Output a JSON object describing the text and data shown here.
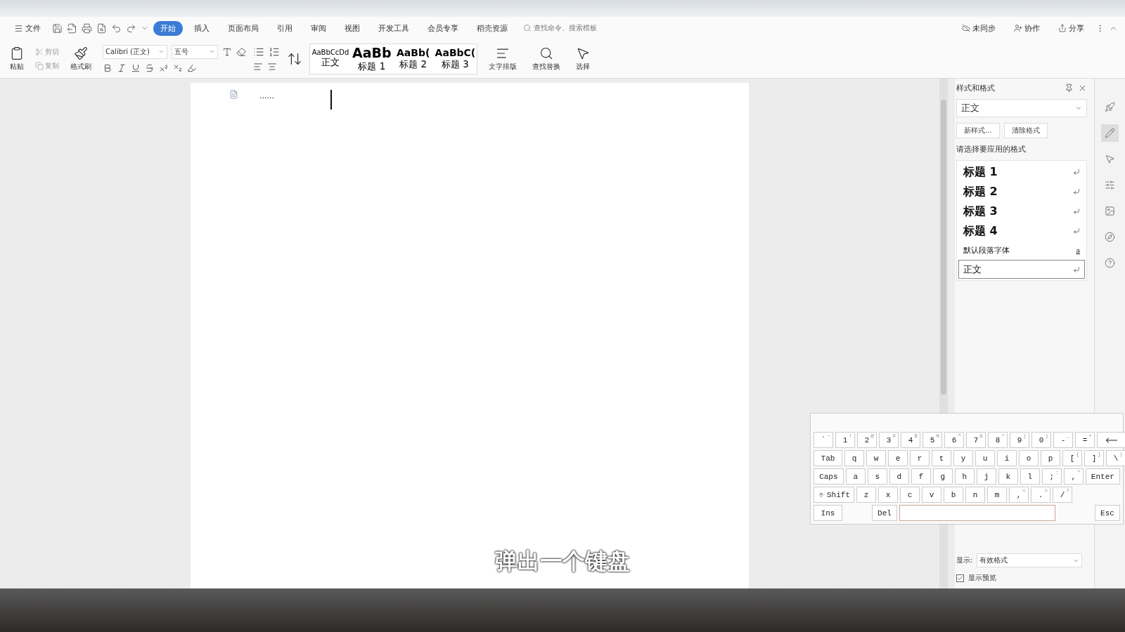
{
  "menu": {
    "file": "文件",
    "tabs": [
      {
        "label": "开始",
        "selected": true
      },
      {
        "label": "插入",
        "selected": false
      },
      {
        "label": "页面布局",
        "selected": false
      },
      {
        "label": "引用",
        "selected": false
      },
      {
        "label": "审阅",
        "selected": false
      },
      {
        "label": "视图",
        "selected": false
      },
      {
        "label": "开发工具",
        "selected": false
      },
      {
        "label": "会员专享",
        "selected": false
      },
      {
        "label": "稻壳资源",
        "selected": false
      }
    ],
    "search": {
      "placeholder": "查找命令、搜索模板"
    },
    "actions": [
      "未同步",
      "协作",
      "分享"
    ]
  },
  "ribbon": {
    "paste": "粘贴",
    "cut": "剪切",
    "copy": "复制",
    "painter": "格式刷",
    "font": "Calibri (正文)",
    "size": "五号",
    "styles": [
      {
        "preview": "AaBbCcDd",
        "label": "正文",
        "kind": "body"
      },
      {
        "preview": "AaBb",
        "label": "标题 1",
        "kind": "h1"
      },
      {
        "preview": "AaBb(",
        "label": "标题 2",
        "kind": "h2"
      },
      {
        "preview": "AaBbC(",
        "label": "标题 3",
        "kind": "h3"
      }
    ],
    "layout": "文字排版",
    "find": "查找替换",
    "select": "选择"
  },
  "document": {
    "text": "......"
  },
  "pane": {
    "title": "样式和格式",
    "current": "正文",
    "buttons": [
      "新样式...",
      "清除格式"
    ],
    "prompt": "请选择要应用的格式",
    "styles": [
      {
        "label": "标题 1",
        "kind": "heading",
        "selected": false
      },
      {
        "label": "标题 2",
        "kind": "heading",
        "selected": false
      },
      {
        "label": "标题 3",
        "kind": "heading",
        "selected": false
      },
      {
        "label": "标题 4",
        "kind": "heading",
        "selected": false
      },
      {
        "label": "默认段落字体",
        "kind": "char",
        "mark": "a",
        "selected": false
      },
      {
        "label": "正文",
        "kind": "para",
        "selected": true
      }
    ],
    "show_label": "显示:",
    "show_value": "有效格式",
    "preview": {
      "label": "显示预览",
      "checked": true
    }
  },
  "keyboard": {
    "rows": [
      [
        {
          "main": "`",
          "shift": "~"
        },
        {
          "main": "1",
          "shift": "!"
        },
        {
          "main": "2",
          "shift": "@"
        },
        {
          "main": "3",
          "shift": "#"
        },
        {
          "main": "4",
          "shift": "$"
        },
        {
          "main": "5",
          "shift": "%"
        },
        {
          "main": "6",
          "shift": "^"
        },
        {
          "main": "7",
          "shift": "&"
        },
        {
          "main": "8",
          "shift": "*"
        },
        {
          "main": "9",
          "shift": "("
        },
        {
          "main": "0",
          "shift": ")"
        },
        {
          "main": "-",
          "shift": "_"
        },
        {
          "main": "=",
          "shift": "+"
        },
        {
          "kind": "backspace"
        }
      ],
      [
        {
          "main": "Tab",
          "kind": "wide"
        },
        {
          "main": "q"
        },
        {
          "main": "w"
        },
        {
          "main": "e"
        },
        {
          "main": "r"
        },
        {
          "main": "t"
        },
        {
          "main": "y"
        },
        {
          "main": "u"
        },
        {
          "main": "i"
        },
        {
          "main": "o"
        },
        {
          "main": "p"
        },
        {
          "main": "[",
          "shift": "{"
        },
        {
          "main": "]",
          "shift": "}"
        },
        {
          "main": "\\",
          "shift": "|"
        }
      ],
      [
        {
          "main": "Caps",
          "kind": "wide"
        },
        {
          "main": "a"
        },
        {
          "main": "s"
        },
        {
          "main": "d"
        },
        {
          "main": "f"
        },
        {
          "main": "g"
        },
        {
          "main": "h"
        },
        {
          "main": "j"
        },
        {
          "main": "k"
        },
        {
          "main": "l"
        },
        {
          "main": ";",
          "shift": ":"
        },
        {
          "main": ",",
          "shift": "\""
        },
        {
          "main": "Enter",
          "kind": "wide"
        }
      ],
      [
        {
          "main": "Shift",
          "kind": "shift"
        },
        {
          "main": "z"
        },
        {
          "main": "x"
        },
        {
          "main": "c"
        },
        {
          "main": "v"
        },
        {
          "main": "b"
        },
        {
          "main": "n"
        },
        {
          "main": "m"
        },
        {
          "main": ",",
          "shift": "<"
        },
        {
          "main": ".",
          "shift": ">"
        },
        {
          "main": "/",
          "shift": "?"
        }
      ]
    ],
    "bottom": {
      "ins": "Ins",
      "del": "Del",
      "esc": "Esc"
    }
  },
  "caption": "弹出一个键盘"
}
